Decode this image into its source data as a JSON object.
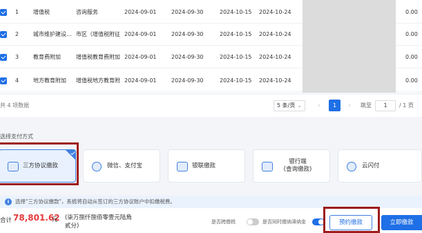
{
  "table": {
    "rows": [
      {
        "no": "1",
        "tax": "增值税",
        "item": "咨询服务",
        "start": "2024-09-01",
        "end": "2024-09-30",
        "filed": "2024-10-15",
        "deadline": "2024-10-24",
        "amount": "0.00"
      },
      {
        "no": "2",
        "tax": "城市维护建设...",
        "item": "市区（增值税附征",
        "start": "2024-09-01",
        "end": "2024-09-30",
        "filed": "2024-10-15",
        "deadline": "2024-10-24",
        "amount": "0.00"
      },
      {
        "no": "3",
        "tax": "教育费附加",
        "item": "增值税教育费附加",
        "start": "2024-09-01",
        "end": "2024-09-30",
        "filed": "2024-10-15",
        "deadline": "2024-10-24",
        "amount": "0.00"
      },
      {
        "no": "4",
        "tax": "地方教育附加",
        "item": "增值税地方教育附",
        "start": "2024-09-01",
        "end": "2024-09-30",
        "filed": "2024-10-15",
        "deadline": "2024-10-24",
        "amount": "0.00"
      }
    ]
  },
  "pagination": {
    "total": "共 4 项数据",
    "page_size": "5 条/页",
    "current": "1",
    "jump_label": "跳至",
    "jump_value": "1",
    "page_total": "/ 1 页"
  },
  "payment": {
    "section_label": "选择支付方式",
    "methods": [
      {
        "label": "三方协议缴款",
        "icon": "shield-icon",
        "selected": true
      },
      {
        "label": "微信、支付宝",
        "icon": "wechat-alipay-icon",
        "selected": false
      },
      {
        "label": "银联缴款",
        "icon": "unionpay-icon",
        "selected": false
      },
      {
        "label": "银行端",
        "label2": "(查询缴款)",
        "icon": "bank-card-icon",
        "selected": false
      },
      {
        "label": "云闪付",
        "icon": "cloud-pay-icon",
        "selected": false
      }
    ],
    "info": "选择\"三方协议缴款\"，系统将自动从签订的三方协议账户中扣缴税费。"
  },
  "footer": {
    "sum_label": "合计",
    "amount": "78,801.62",
    "unit": "元",
    "amount_words": "(柒万捌仟捌佰零壹元陆角贰分)",
    "toggle1_label": "是否跨缴税",
    "toggle2_label": "是否同时缴纳滞纳金",
    "reserve_button": "预约缴款",
    "pay_button": "立即缴款"
  },
  "colors": {
    "primary": "#1f6fe6",
    "amount": "#e4393c",
    "highlight": "#9e1b1b"
  }
}
